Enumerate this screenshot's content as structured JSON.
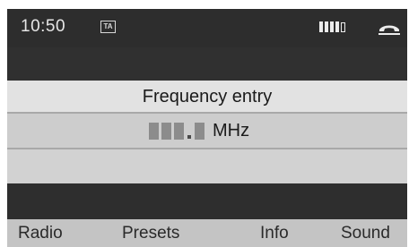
{
  "status_bar": {
    "time": "10:50",
    "ta_badge": "TA",
    "signal_bars_filled": 4,
    "signal_bars_total": 5,
    "phone_icon": "phone-hangup-icon"
  },
  "dialog": {
    "title": "Frequency entry",
    "frequency_unit": "MHz",
    "frequency_value": ""
  },
  "softkeys": {
    "radio": "Radio",
    "presets": "Presets",
    "info": "Info",
    "sound": "Sound"
  },
  "colors": {
    "screen_dark": "#2b2b2b",
    "panel_light": "#dcdcdc",
    "softkey_bar": "#c4c4c4"
  }
}
